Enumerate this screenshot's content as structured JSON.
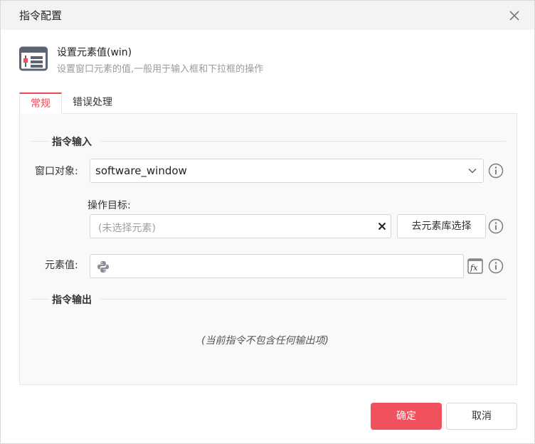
{
  "dialog": {
    "title": "指令配置"
  },
  "command": {
    "name": "设置元素值(win)",
    "description": "设置窗口元素的值,一般用于输入框和下拉框的操作"
  },
  "tabs": [
    {
      "label": "常规",
      "active": true
    },
    {
      "label": "错误处理",
      "active": false
    }
  ],
  "input_section": {
    "title": "指令输入",
    "window_object": {
      "label": "窗口对象:",
      "value": "software_window"
    },
    "target": {
      "label": "操作目标:",
      "placeholder": "(未选择元素)",
      "library_button": "去元素库选择"
    },
    "element_value": {
      "label": "元素值:",
      "value": ""
    }
  },
  "output_section": {
    "title": "指令输出",
    "empty_text": "(当前指令不包含任何输出项)"
  },
  "footer": {
    "ok_label": "确定",
    "cancel_label": "取消"
  },
  "colors": {
    "accent": "#f0525d",
    "tab_active": "#e94a55"
  },
  "icons": {
    "command": "window-form-icon",
    "close": "close-icon",
    "info": "info-icon",
    "python": "python-icon",
    "fx": "fx-icon",
    "caret": "chevron-down-icon",
    "clear": "clear-icon"
  }
}
